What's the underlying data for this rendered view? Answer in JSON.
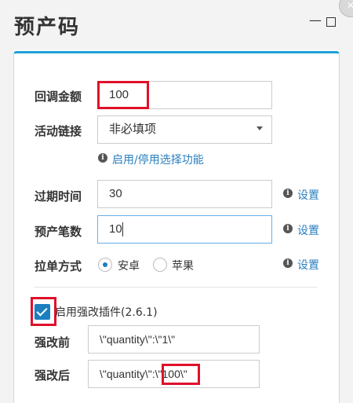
{
  "window": {
    "title": "预产码",
    "minimize": "—"
  },
  "form": {
    "callback_amount": {
      "label": "回调金额",
      "value": "100"
    },
    "activity_link": {
      "label": "活动链接",
      "selected": "非必填项",
      "hint": "启用/停用选择功能"
    },
    "expire_time": {
      "label": "过期时间",
      "value": "30",
      "settings": "设置"
    },
    "preproduce_count": {
      "label": "预产笔数",
      "value": "10",
      "settings": "设置"
    },
    "pull_method": {
      "label": "拉单方式",
      "options": [
        "安卓",
        "苹果"
      ],
      "selected": "安卓",
      "settings": "设置"
    },
    "plugin": {
      "label": "启用强改插件(2.6.1)",
      "checked": true
    },
    "before": {
      "label": "强改前",
      "value": "\\\"quantity\\\":\\\"1\\\""
    },
    "after": {
      "label": "强改后",
      "value": "\\\"quantity\\\":\\\"100\\\""
    }
  },
  "colors": {
    "accent": "#1ea0d9",
    "link": "#2a7fc0",
    "highlight": "#e0102a",
    "checkbox": "#1a7fc0"
  }
}
